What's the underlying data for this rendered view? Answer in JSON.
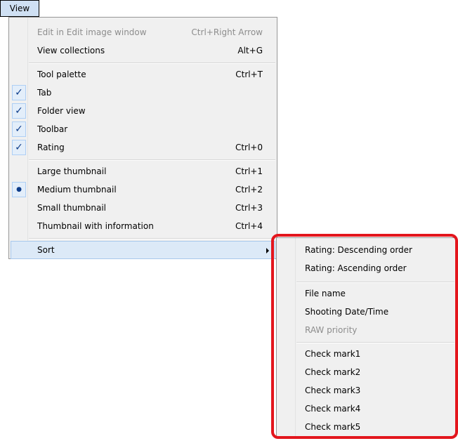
{
  "menubar": {
    "view_label": "View"
  },
  "view_menu": {
    "items": [
      {
        "label": "Edit in Edit image window",
        "shortcut": "Ctrl+Right Arrow",
        "disabled": true
      },
      {
        "label": "View collections",
        "shortcut": "Alt+G"
      },
      {
        "label": "Tool palette",
        "shortcut": "Ctrl+T"
      },
      {
        "label": "Tab",
        "shortcut": "",
        "checked": true
      },
      {
        "label": "Folder view",
        "shortcut": "",
        "checked": true
      },
      {
        "label": "Toolbar",
        "shortcut": "",
        "checked": true
      },
      {
        "label": "Rating",
        "shortcut": "Ctrl+0",
        "checked": true
      },
      {
        "label": "Large thumbnail",
        "shortcut": "Ctrl+1"
      },
      {
        "label": "Medium thumbnail",
        "shortcut": "Ctrl+2",
        "radio": true
      },
      {
        "label": "Small thumbnail",
        "shortcut": "Ctrl+3"
      },
      {
        "label": "Thumbnail with information",
        "shortcut": "Ctrl+4"
      },
      {
        "label": "Sort",
        "shortcut": "",
        "submenu": true,
        "selected": true
      }
    ],
    "check_glyph": "✓",
    "radio_glyph": "●"
  },
  "sort_menu": {
    "items": [
      {
        "label": "Rating: Descending order"
      },
      {
        "label": "Rating: Ascending order"
      },
      {
        "label": "File name"
      },
      {
        "label": "Shooting Date/Time"
      },
      {
        "label": "RAW priority",
        "disabled": true
      },
      {
        "label": "Check mark1"
      },
      {
        "label": "Check mark2"
      },
      {
        "label": "Check mark3"
      },
      {
        "label": "Check mark4"
      },
      {
        "label": "Check mark5"
      }
    ]
  },
  "colors": {
    "highlight": "#e3161d",
    "check": "#0d3c8a",
    "menu_bg": "#f0f0f0"
  }
}
